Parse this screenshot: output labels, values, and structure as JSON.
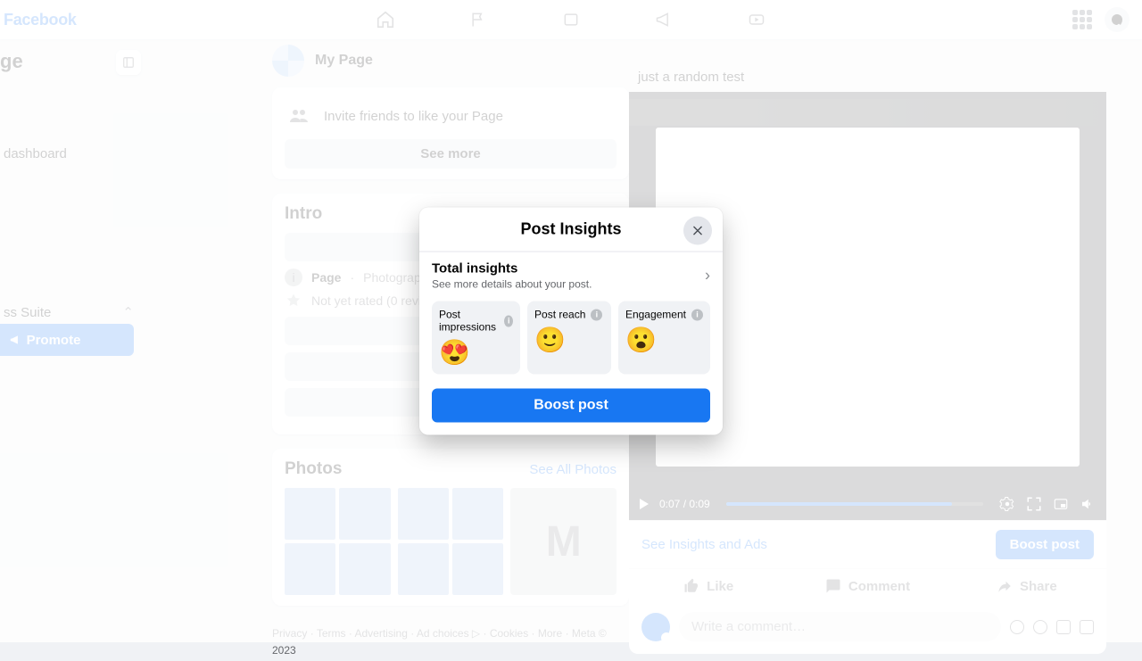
{
  "brand": "Facebook",
  "leftpane": {
    "title_fragment": "ge",
    "item_dashboard": "dashboard",
    "item_suite": "ss Suite",
    "promote": "Promote"
  },
  "page": {
    "name": "My Page",
    "invite": "Invite friends to like your Page",
    "see_more": "See more",
    "intro": "Intro",
    "meta_page": "Page",
    "meta_category": "Photography an",
    "rating": "Not yet rated (0 review",
    "photos": "Photos",
    "see_all_photos": "See All Photos",
    "photo_m": "M"
  },
  "footer": {
    "l1": "Privacy",
    "l2": "Terms",
    "l3": "Advertising",
    "l4": "Ad choices ▷",
    "l5": "Cookies",
    "l6": "More",
    "l7": "Meta © 2023"
  },
  "post": {
    "caption": "just a random test",
    "time": "0:07 / 0:09",
    "insights_link": "See Insights and Ads",
    "boost": "Boost post",
    "like": "Like",
    "comment": "Comment",
    "share": "Share",
    "comment_placeholder": "Write a comment…"
  },
  "modal": {
    "title": "Post Insights",
    "total": "Total insights",
    "total_sub": "See more details about your post.",
    "metrics": {
      "impressions": {
        "label": "Post impressions",
        "emoji": "😍"
      },
      "reach": {
        "label": "Post reach",
        "emoji": "🙂"
      },
      "engagement": {
        "label": "Engagement",
        "emoji": "😮"
      }
    },
    "boost": "Boost post"
  }
}
